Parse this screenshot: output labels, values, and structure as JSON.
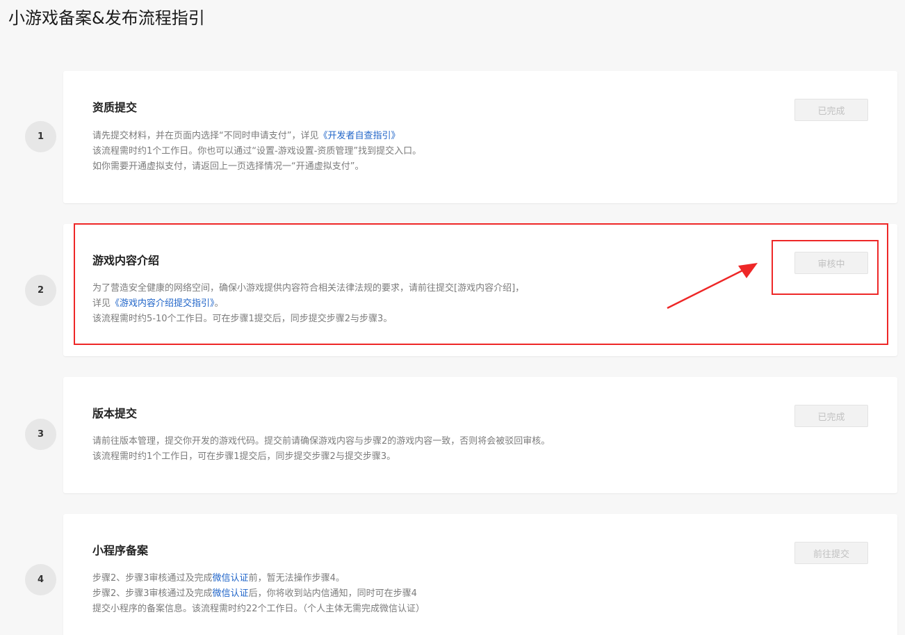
{
  "page": {
    "title": "小游戏备案&发布流程指引"
  },
  "colors": {
    "link": "#1f64c8",
    "highlight": "#ee2727",
    "card_bg": "#ffffff",
    "page_bg": "#f7f7f7"
  },
  "steps": [
    {
      "number": "1",
      "title": "资质提交",
      "status": "已完成",
      "lines": [
        {
          "pre": "请先提交材料，并在页面内选择“不同时申请支付”，详见",
          "link": "《开发者自查指引》",
          "post": ""
        },
        {
          "pre": "该流程需时约1个工作日。你也可以通过“设置-游戏设置-资质管理”找到提交入口。",
          "link": "",
          "post": ""
        },
        {
          "pre": "如你需要开通虚拟支付，请返回上一页选择情况一“开通虚拟支付”。",
          "link": "",
          "post": ""
        }
      ]
    },
    {
      "number": "2",
      "title": "游戏内容介绍",
      "status": "审核中",
      "lines": [
        {
          "pre": "为了营造安全健康的网络空间，确保小游戏提供内容符合相关法律法规的要求，请前往提交[游戏内容介绍]，",
          "link": "",
          "post": ""
        },
        {
          "pre": "详见",
          "link": "《游戏内容介绍提交指引》",
          "post": "。"
        },
        {
          "pre": "该流程需时约5-10个工作日。可在步骤1提交后，同步提交步骤2与步骤3。",
          "link": "",
          "post": ""
        }
      ]
    },
    {
      "number": "3",
      "title": "版本提交",
      "status": "已完成",
      "lines": [
        {
          "pre": "请前往版本管理，提交你开发的游戏代码。提交前请确保游戏内容与步骤2的游戏内容一致，否则将会被驳回审核。",
          "link": "",
          "post": ""
        },
        {
          "pre": "该流程需时约1个工作日，可在步骤1提交后，同步提交步骤2与提交步骤3。",
          "link": "",
          "post": ""
        }
      ]
    },
    {
      "number": "4",
      "title": "小程序备案",
      "status": "前往提交",
      "lines": [
        {
          "pre": "步骤2、步骤3审核通过及完成",
          "link": "微信认证",
          "post": "前，暂无法操作步骤4。"
        },
        {
          "pre": "步骤2、步骤3审核通过及完成",
          "link": "微信认证",
          "post": "后，你将收到站内信通知，同时可在步骤4"
        },
        {
          "pre": "提交小程序的备案信息。该流程需时约22个工作日。（个人主体无需完成微信认证）",
          "link": "",
          "post": ""
        }
      ]
    }
  ]
}
